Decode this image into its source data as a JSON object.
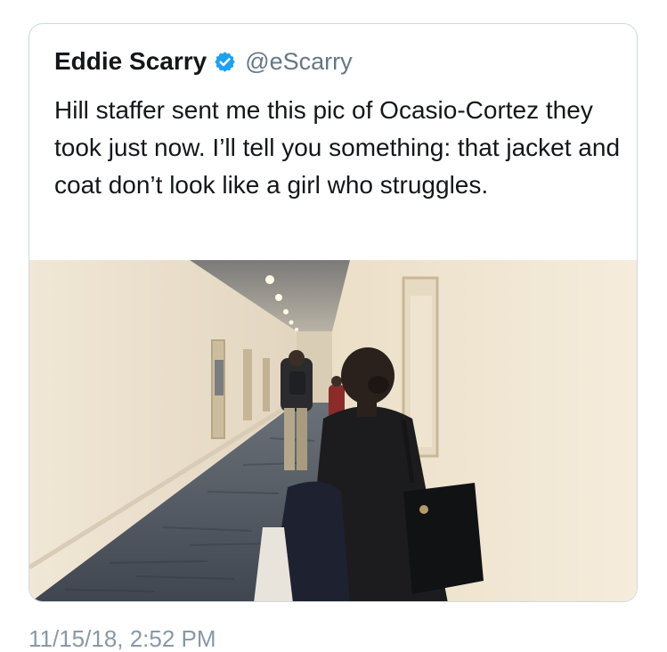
{
  "tweet": {
    "display_name": "Eddie Scarry",
    "handle": "@eScarry",
    "text": "Hill staffer sent me this pic of Ocasio-Cortez they took just now. I’ll tell you something: that jacket and coat don’t look like a girl who struggles.",
    "verified_icon": "verified-badge-icon",
    "photo_description_icon": "photo",
    "timestamp": "11/15/18, 2:52 PM"
  },
  "colors": {
    "verified": "#1da1f2",
    "name": "#14171a",
    "handle": "#657786",
    "border": "#cfd9de"
  }
}
